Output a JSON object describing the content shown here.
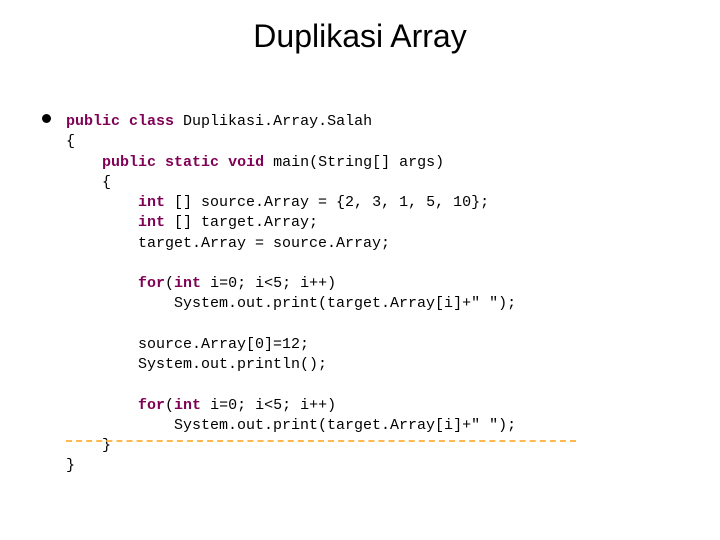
{
  "title": "Duplikasi Array",
  "code": {
    "l01a": "public",
    "l01b": " ",
    "l01c": "class",
    "l01d": " Duplikasi.Array.Salah",
    "l02": "{",
    "l03a": "    ",
    "l03b": "public",
    "l03c": " ",
    "l03d": "static",
    "l03e": " ",
    "l03f": "void",
    "l03g": " main(String[] args)",
    "l04": "    {",
    "l05a": "        ",
    "l05b": "int",
    "l05c": " [] source.Array = {2, 3, 1, 5, 10};",
    "l06a": "        ",
    "l06b": "int",
    "l06c": " [] target.Array;",
    "l07": "        target.Array = source.Array;",
    "l08": "",
    "l09a": "        ",
    "l09b": "for",
    "l09c": "(",
    "l09d": "int",
    "l09e": " i=0; i<5; i++)",
    "l10": "            System.out.print(target.Array[i]+\" \");",
    "l11": "",
    "l12": "        source.Array[0]=12;",
    "l13": "        System.out.println();",
    "l14": "",
    "l15a": "        ",
    "l15b": "for",
    "l15c": "(",
    "l15d": "int",
    "l15e": " i=0; i<5; i++)",
    "l16": "            System.out.print(target.Array[i]+\" \");",
    "l17": "    }",
    "l18": "}"
  }
}
